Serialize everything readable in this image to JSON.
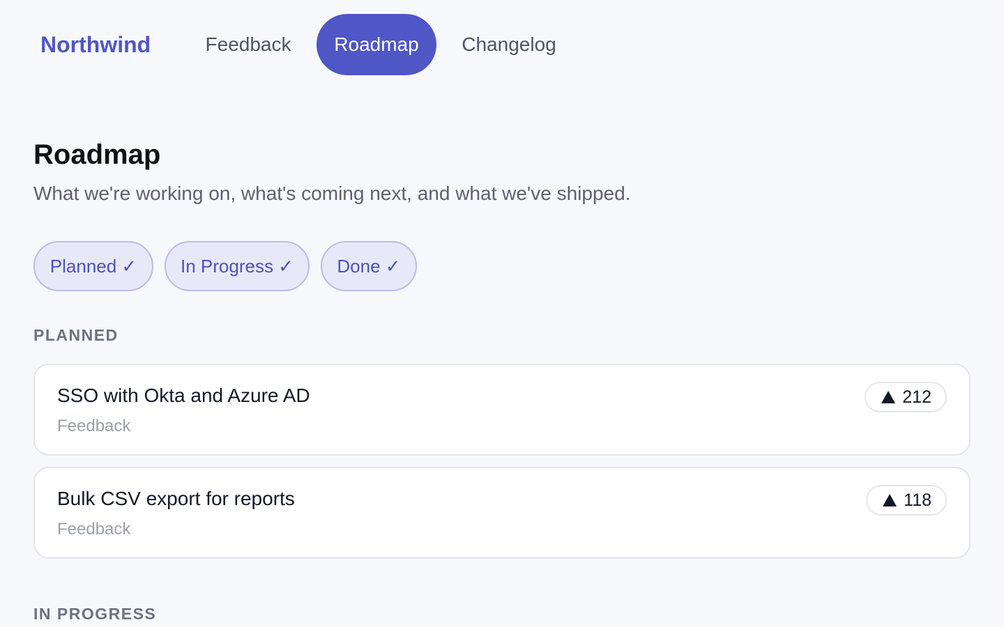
{
  "nav": {
    "brand": "Northwind",
    "tabs": [
      {
        "label": "Feedback",
        "active": false
      },
      {
        "label": "Roadmap",
        "active": true
      },
      {
        "label": "Changelog",
        "active": false
      }
    ]
  },
  "page": {
    "title": "Roadmap",
    "subtitle": "What we're working on, what's coming next, and what we've shipped."
  },
  "filters": [
    {
      "label": "Planned ✓",
      "selected": true
    },
    {
      "label": "In Progress ✓",
      "selected": true
    },
    {
      "label": "Done ✓",
      "selected": true
    }
  ],
  "sections": {
    "planned": {
      "label": "PLANNED",
      "items": [
        {
          "title": "SSO with Okta and Azure AD",
          "source": "Feedback",
          "votes": "212"
        },
        {
          "title": "Bulk CSV export for reports",
          "source": "Feedback",
          "votes": "118"
        }
      ]
    },
    "in_progress": {
      "label": "IN PROGRESS"
    }
  },
  "icons": {
    "upvote": "triangle-up-icon",
    "check": "check-icon"
  },
  "colors": {
    "accent": "#4f56c6",
    "background": "#f7f8fb",
    "chip_bg": "#e8e9f8",
    "chip_border": "#b9bce8"
  }
}
